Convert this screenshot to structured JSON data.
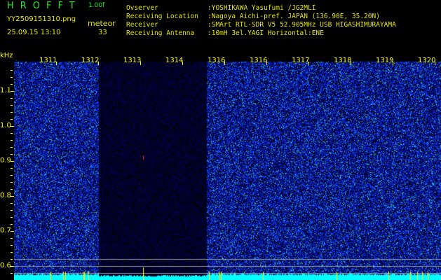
{
  "header": {
    "app": "HROFFT",
    "version": "1.00f",
    "filename": "YY2509151310.png",
    "datetime": "25.09.15 13:10",
    "mode": "meteor",
    "count": "33"
  },
  "info": [
    {
      "label": "Ovserver",
      "value": ":YOSHIKAWA Yasufumi /JG2MLI"
    },
    {
      "label": "Receiving Location",
      "value": ":Nagoya Aichi-pref. JAPAN (136.90E, 35.20N)"
    },
    {
      "label": "Receiver",
      "value": ":SMArt RTL-SDR V5 52.905MHz USB HIGASHIMURAYAMA"
    },
    {
      "label": "Receiving Antenna",
      "value": ":10mH 3el.YAGI Horizontal:ENE"
    }
  ],
  "axis": {
    "unit": "kHz",
    "freq_labels": [
      "1311",
      "1312",
      "1313",
      "1314",
      "1316",
      "1316",
      "1317",
      "1318",
      "1319",
      "1320"
    ],
    "y_labels": [
      "1.1",
      "1.0",
      "0.9",
      "0.8",
      "0.7",
      "0.6"
    ]
  },
  "colors": {
    "text": "#e6e600",
    "logo": "#2fe02f",
    "baseline": "#00ffff"
  }
}
